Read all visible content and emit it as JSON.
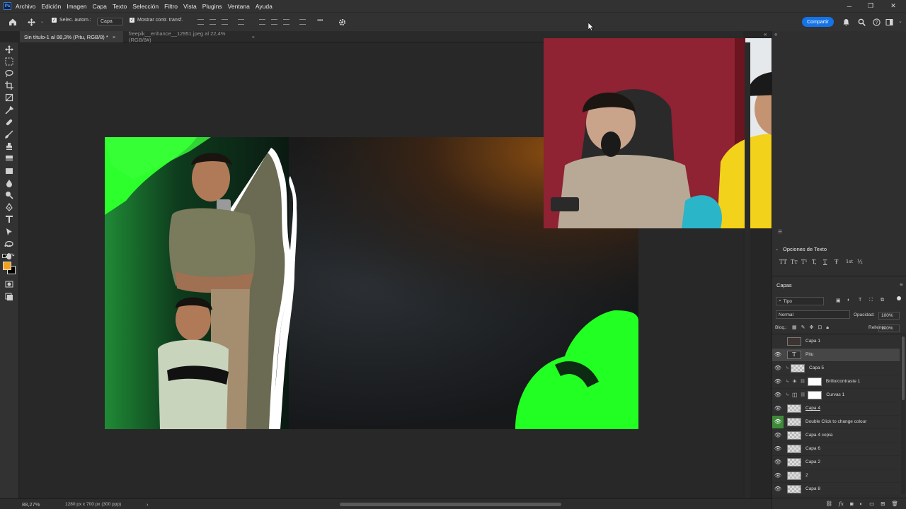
{
  "menubar": {
    "items": [
      "Archivo",
      "Edición",
      "Imagen",
      "Capa",
      "Texto",
      "Selección",
      "Filtro",
      "Vista",
      "Plugins",
      "Ventana",
      "Ayuda"
    ]
  },
  "options": {
    "auto_select_label": "Selec. autom.:",
    "auto_select_target": "Capa",
    "show_transform_label": "Mostrar contr. transf.",
    "share_label": "Compartir",
    "more_label": "•••"
  },
  "tabs": [
    {
      "label": "Sin título-1 al 88,3% (Pitu, RGB/8) *",
      "close": "×"
    },
    {
      "label": "freepik__enhance__12951.jpeg al 22,4% (RGB/8#)",
      "close": "×"
    }
  ],
  "status": {
    "zoom": "88,27%",
    "doc_info": "1280 px x 700 px (300 ppp)",
    "arrow": "›"
  },
  "text_options": {
    "title": "Opciones de Texto",
    "glyphs": [
      "TT",
      "Tт",
      "T¹",
      "T,",
      "T",
      "Ŧ",
      "1st",
      "½"
    ]
  },
  "layers_panel": {
    "title": "Capas",
    "filter_label": "Tipo",
    "blend_mode": "Normal",
    "opacity_label": "Opacidad:",
    "opacity_value": "100%",
    "lock_label": "Bloq.:",
    "fill_label": "Relleno:",
    "fill_value": "100%",
    "layers": [
      {
        "name": "Capa 1",
        "visible": false,
        "selected": false,
        "type": "photo"
      },
      {
        "name": "Pitu",
        "visible": true,
        "selected": true,
        "type": "text"
      },
      {
        "name": "Capa 5",
        "visible": true,
        "selected": false,
        "type": "pixel"
      },
      {
        "name": "Brillo/contraste 1",
        "visible": true,
        "selected": false,
        "type": "adjustment"
      },
      {
        "name": "Curvas 1",
        "visible": true,
        "selected": false,
        "type": "adjustment"
      },
      {
        "name": "Capa 4",
        "visible": true,
        "selected": false,
        "type": "pixel"
      },
      {
        "name": "Double Click to change colour",
        "visible": true,
        "selected": false,
        "type": "pixel",
        "highlight": true
      },
      {
        "name": "Capa 4 copia",
        "visible": true,
        "selected": false,
        "type": "pixel"
      },
      {
        "name": "Capa 6",
        "visible": true,
        "selected": false,
        "type": "pixel"
      },
      {
        "name": "Capa 2",
        "visible": true,
        "selected": false,
        "type": "pixel"
      },
      {
        "name": "2",
        "visible": true,
        "selected": false,
        "type": "pixel"
      },
      {
        "name": "Capa 8",
        "visible": true,
        "selected": false,
        "type": "pixel"
      }
    ]
  },
  "colors": {
    "foreground": "#f0a21c",
    "background": "#000000",
    "accent": "#1473e6",
    "neon_green": "#22ff22"
  }
}
